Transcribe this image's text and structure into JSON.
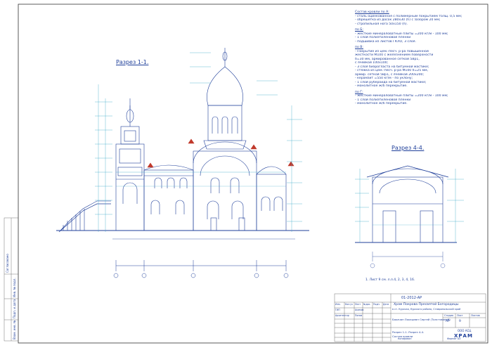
{
  "sections": {
    "main_title": "Разрез 1-1.",
    "secondary_title": "Разрез 4-4."
  },
  "notes": {
    "heading_a": "Состав кровли по А:",
    "a_items": [
      "- сталь оцинкованная с полимерным покрытием толщ. 0,5 мм;",
      "- обрешетка из досок 280х30 (h) с зазором 20 мм;",
      "- стропильная нога 50х150 (h)."
    ],
    "heading_b": "по Б:",
    "b_items": [
      "- жесткие минераловатные плиты =200 кг/м - 100 мм;",
      "- 1 слой полиэтиленовой пленки",
      "- подшивка из листов ГКЛО, 3 слоя."
    ],
    "heading_v": "по В:",
    "v_items": [
      "- Покрытие из цем.-песч. р-ра повышенной",
      "  жесткости М100 с железнением поверхности",
      "  δ=30 мм, армированное сеткой 5Вр1,",
      "  с ячейкой 100х100;",
      "- 3 слоя биэрогласта на битумной мастике;",
      "- стяжка из цем.-песч. р-ра М100 δ=25 мм,",
      "  армир. сеткой 5Вр1, с ячейкой 200х200;",
      "- керамзит =550 кг/м - по уклону;",
      "- 1 слой рубероида на битумной мастике;",
      "- монолитное ж/б перекрытие."
    ],
    "heading_g": "по Г:",
    "g_items": [
      "- жесткие минераловатные плиты =200 кг/м - 100 мм;",
      "- 1 слой полиэтиленовой пленки",
      "- монолитное ж/б перекрытие."
    ]
  },
  "footnote": "1. Лист 9 см. л.л.4, 2, 3, 4, 16.",
  "stamp": {
    "doc_code": "01-2012-АР",
    "project_name": "Храм Покрова Пресвятой Богородицы",
    "location": "в ст. Курская, Курского района, Ставропольский край",
    "author_line": "Бакачан Локацман Сергей (Толстяковой)",
    "stage_header": "Стадия",
    "sheet_header": "Лист",
    "sheets_header": "Листов",
    "stage": "АР",
    "sheet": "9",
    "sheet_title_1": "Разрез 1-1. Разрез 4-4.",
    "sheet_title_2": "Состав кровли",
    "org": "ООО АСЦ",
    "org_logo": "ХРАМ",
    "role_1": "Изм.",
    "role_2": "Кол.уч",
    "role_3": "Лист",
    "role_4": "№док.",
    "role_5": "Подп.",
    "role_6": "Дата",
    "gip": "ГИП",
    "gip_name": "Акимов",
    "arch": "Архитектор",
    "arch_name": "Попов",
    "format": "Формат А3",
    "copied": "Копировал"
  },
  "side_stamp": {
    "agreed": "Согласовано",
    "inv": "Инв. № подл.",
    "sign_date": "Подп. и дата",
    "replace": "Взам. инв. №"
  },
  "colors": {
    "line": "#1f3f9a",
    "dim": "#3aa7c9",
    "frame": "#333333",
    "accent": "#c0392b"
  }
}
